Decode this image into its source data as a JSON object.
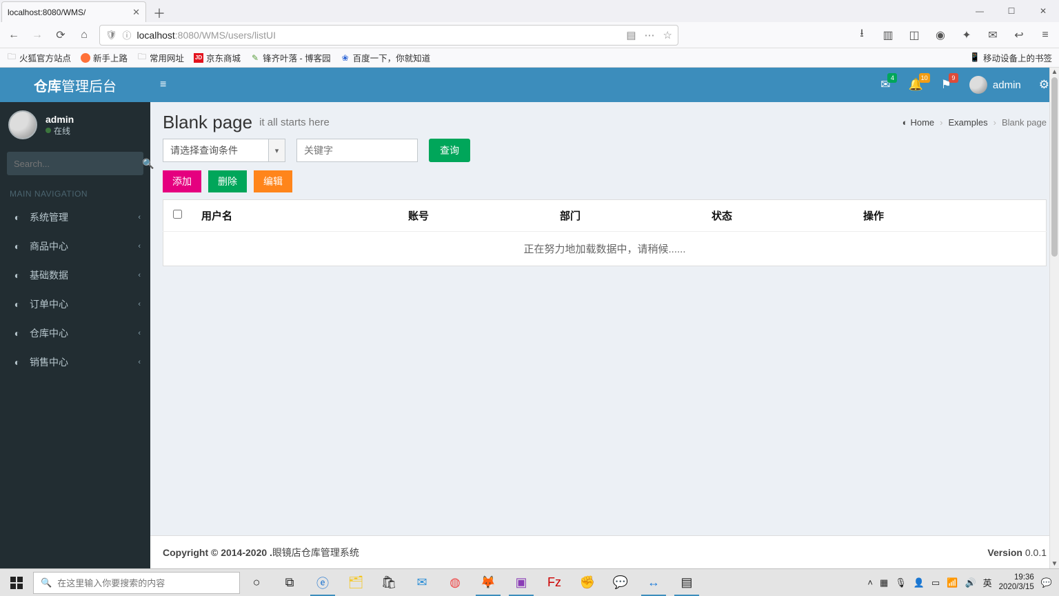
{
  "browser": {
    "tab_title": "localhost:8080/WMS/",
    "url_display": {
      "prefix": "localhost",
      "rest": ":8080/WMS/users/listUI"
    },
    "bookmarks": [
      "火狐官方站点",
      "新手上路",
      "常用网址",
      "京东商城",
      "锋齐叶落 - 博客园",
      "百度一下，你就知道"
    ],
    "mobile_bm": "移动设备上的书签"
  },
  "app": {
    "brand_bold": "仓库",
    "brand_rest": "管理后台",
    "user_name": "admin",
    "user_status": "在线",
    "search_placeholder": "Search...",
    "nav_header": "MAIN NAVIGATION",
    "nav_items": [
      "系统管理",
      "商品中心",
      "基础数据",
      "订单中心",
      "仓库中心",
      "销售中心"
    ],
    "badges": {
      "mail": "4",
      "bell": "10",
      "flag": "9"
    },
    "header_user": "admin"
  },
  "page": {
    "title": "Blank page",
    "subtitle": "it all starts here",
    "breadcrumb": {
      "home": "Home",
      "mid": "Examples",
      "last": "Blank page"
    },
    "select_placeholder": "请选择查询条件",
    "keyword_placeholder": "关键字",
    "query_btn": "查询",
    "add_btn": "添加",
    "del_btn": "删除",
    "edit_btn": "编辑",
    "cols": [
      "用户名",
      "账号",
      "部门",
      "状态",
      "操作"
    ],
    "loading_text": "正在努力地加载数据中，请稍候......"
  },
  "footer": {
    "copyright_bold": "Copyright © 2014-2020 .",
    "copyright_rest": "眼镜店仓库管理系统",
    "version_label": "Version",
    "version_value": " 0.0.1"
  },
  "taskbar": {
    "search_placeholder": "在这里输入你要搜索的内容",
    "ime": "英",
    "time": "19:36",
    "date": "2020/3/15"
  }
}
